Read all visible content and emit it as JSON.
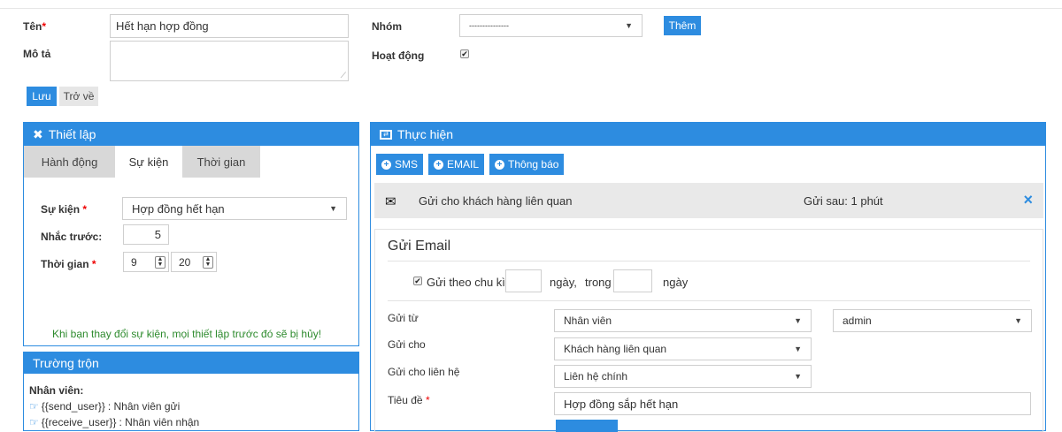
{
  "form": {
    "name_label": "Tên",
    "required_mark": "*",
    "name_value": "Hết hạn hợp đồng",
    "desc_label": "Mô tả",
    "desc_value": "",
    "group_label": "Nhóm",
    "group_value": "---------------",
    "add_button": "Thêm",
    "active_label": "Hoạt động",
    "active_checked": true,
    "save_button": "Lưu",
    "back_button": "Trở về"
  },
  "settings": {
    "title": "Thiết lập",
    "icon": "tools-icon",
    "tabs": [
      {
        "label": "Hành động",
        "active": false
      },
      {
        "label": "Sự kiện",
        "active": true
      },
      {
        "label": "Thời gian",
        "active": false
      }
    ],
    "event_label": "Sự kiện",
    "event_value": "Hợp đồng hết hạn",
    "remind_label": "Nhắc trước:",
    "remind_value": "5",
    "time_label": "Thời gian",
    "time_hour": "9",
    "time_minute": "20",
    "warning": "Khi bạn thay đổi sự kiện, mọi thiết lập trước đó sẽ bị hủy!"
  },
  "merge_fields": {
    "title": "Trường trộn",
    "group_label": "Nhân viên:",
    "items": [
      {
        "code": "{{send_user}}",
        "desc": ": Nhân viên gửi"
      },
      {
        "code": "{{receive_user}}",
        "desc": ": Nhân viên nhận"
      }
    ]
  },
  "execute": {
    "title": "Thực hiện",
    "icon": "execute-icon",
    "buttons": [
      "SMS",
      "EMAIL",
      "Thông báo"
    ],
    "action_row": {
      "icon": "envelope-icon",
      "text": "Gửi cho khách hàng liên quan",
      "delay": "Gửi sau: 1 phút",
      "remove": "×"
    },
    "email": {
      "title": "Gửi Email",
      "periodic_checked": true,
      "periodic_label": "Gửi theo chu kì",
      "days_label": "ngày,",
      "within_label": "trong",
      "days_label_2": "ngày",
      "periodic_every": "",
      "periodic_within": "",
      "from_label": "Gửi từ",
      "from_value": "Nhân viên",
      "from_user": "admin",
      "to_label": "Gửi cho",
      "to_value": "Khách hàng liên quan",
      "contact_label": "Gửi cho liên hệ",
      "contact_value": "Liên hệ chính",
      "subject_label": "Tiêu đề",
      "subject_value": "Hợp đồng sắp hết hạn"
    }
  },
  "colors": {
    "primary": "#2d8ce0",
    "warning_text": "#2e8b2e",
    "required": "#e00000"
  }
}
